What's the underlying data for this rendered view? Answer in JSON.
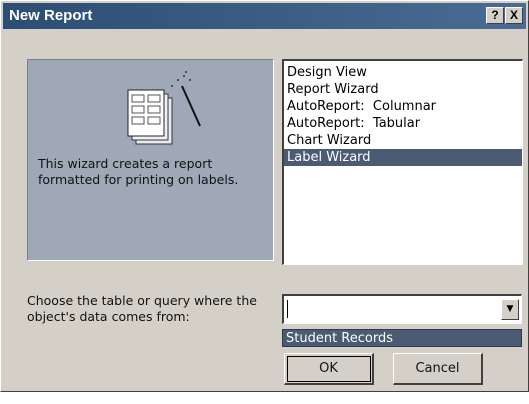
{
  "window": {
    "title": "New Report",
    "help_label": "?",
    "close_label": "X"
  },
  "preview": {
    "icon": "report-wizard-icon",
    "description": "This wizard creates a report formatted for printing on labels."
  },
  "wizard_list": {
    "items": [
      {
        "label": "Design View"
      },
      {
        "label": "Report Wizard"
      },
      {
        "label": "AutoReport:  Columnar"
      },
      {
        "label": "AutoReport:  Tabular"
      },
      {
        "label": "Chart Wizard"
      },
      {
        "label": "Label Wizard"
      }
    ],
    "selected": "Label Wizard"
  },
  "source": {
    "prompt": "Choose the table or query where the object's data comes from:",
    "value": "",
    "dropdown_option": "Student Records"
  },
  "buttons": {
    "ok": "OK",
    "cancel": "Cancel"
  },
  "colors": {
    "title_bar": "#2c4e74",
    "selection": "#4a5b73",
    "preview_bg": "#9fa8b7",
    "dialog_bg": "#d4d0c8"
  }
}
